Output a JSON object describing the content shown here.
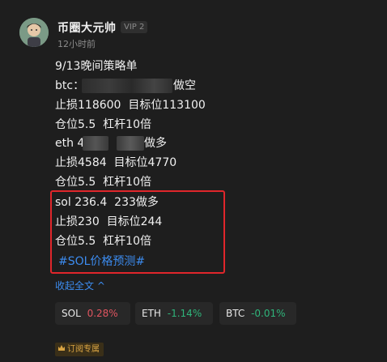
{
  "post": {
    "username": "币圈大元帅",
    "vip_badge": "VIP 2",
    "time_ago": "12小时前",
    "lines": {
      "title": "9/13晚间策略单",
      "btc_prefix": "btc：",
      "btc_suffix": "做空",
      "btc_stop": "止损118600  目标位113100",
      "btc_position": "仓位5.5  杠杆10倍",
      "eth_prefix": "eth 4",
      "eth_suffix": "做多",
      "eth_stop": "止损4584  目标位4770",
      "eth_position": "仓位5.5  杠杆10倍",
      "sol_entry": "sol 236.4  233做多",
      "sol_stop": "止损230  目标位244",
      "sol_position": "仓位5.5  杠杆10倍"
    },
    "hashtag": "#SOL价格预测#",
    "collapse_label": "收起全文 ^"
  },
  "tickers": [
    {
      "symbol": "SOL",
      "change": "0.28%",
      "direction": "up"
    },
    {
      "symbol": "ETH",
      "change": "-1.14%",
      "direction": "down"
    },
    {
      "symbol": "BTC",
      "change": "-0.01%",
      "direction": "down"
    }
  ],
  "subscription_badge": "订阅专属",
  "colors": {
    "background": "#1e1e1e",
    "link": "#3c8cf0",
    "highlight_border": "#e0262b",
    "up": "#e05560",
    "down": "#2fb47a"
  }
}
